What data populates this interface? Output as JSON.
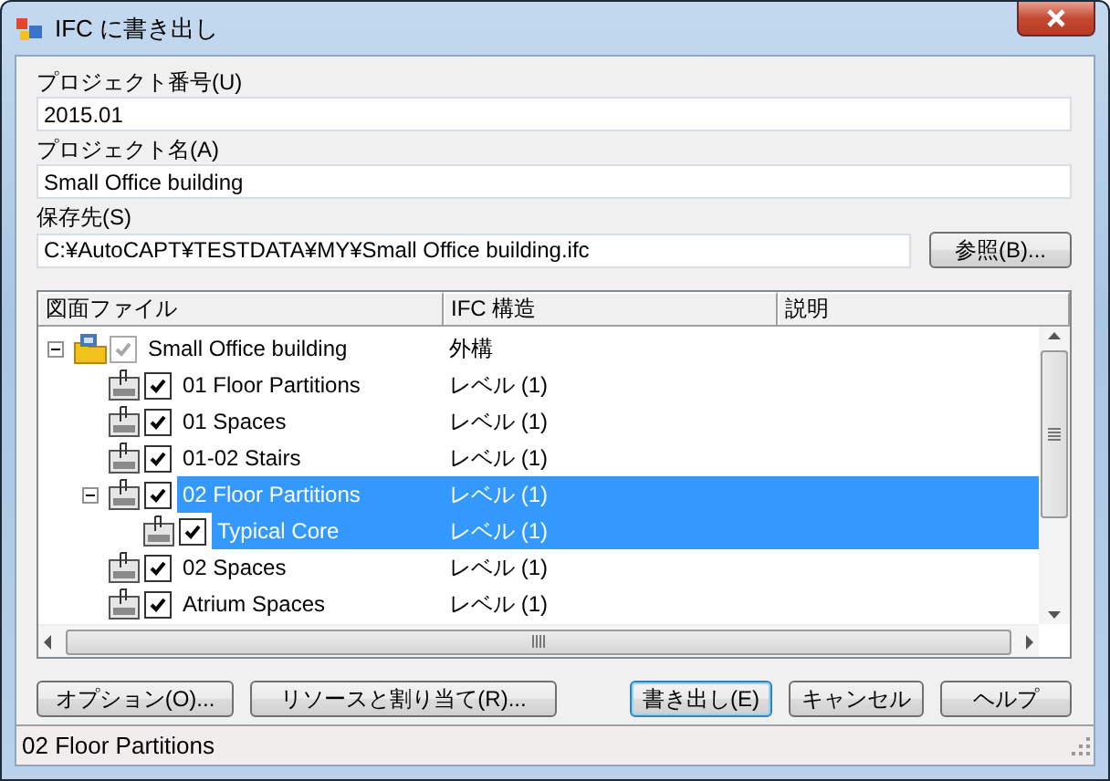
{
  "window": {
    "title": "IFC に書き出し"
  },
  "fields": [
    {
      "label": "プロジェクト番号(U)",
      "value": "2015.01"
    },
    {
      "label": "プロジェクト名(A)",
      "value": "Small Office building"
    },
    {
      "label": "保存先(S)",
      "value": "C:¥AutoCAPT¥TESTDATA¥MY¥Small Office building.ifc",
      "button": "参照(B)..."
    }
  ],
  "tree": {
    "columns": [
      "図面ファイル",
      "IFC 構造",
      "説明"
    ],
    "items": [
      {
        "name": "Small Office building",
        "structure": "外構",
        "kind": "project",
        "checked": true,
        "disabled": true,
        "expanded": true,
        "selected": false,
        "children": [
          {
            "name": "01 Floor Partitions",
            "structure": "レベル (1)",
            "kind": "drawing",
            "checked": true,
            "disabled": false,
            "selected": false
          },
          {
            "name": "01 Spaces",
            "structure": "レベル (1)",
            "kind": "drawing",
            "checked": true,
            "disabled": false,
            "selected": false
          },
          {
            "name": "01-02 Stairs",
            "structure": "レベル (1)",
            "kind": "drawing",
            "checked": true,
            "disabled": false,
            "selected": false
          },
          {
            "name": "02 Floor Partitions",
            "structure": "レベル (1)",
            "kind": "drawing",
            "checked": true,
            "disabled": false,
            "expanded": true,
            "selected": true,
            "children": [
              {
                "name": "Typical Core",
                "structure": "レベル (1)",
                "kind": "drawing",
                "checked": true,
                "disabled": false,
                "selected": true
              }
            ]
          },
          {
            "name": "02 Spaces",
            "structure": "レベル (1)",
            "kind": "drawing",
            "checked": true,
            "disabled": false,
            "selected": false
          },
          {
            "name": "Atrium Spaces",
            "structure": "レベル (1)",
            "kind": "drawing",
            "checked": true,
            "disabled": false,
            "selected": false
          }
        ]
      }
    ]
  },
  "buttons": [
    {
      "label": "オプション(O)...",
      "default": false
    },
    {
      "label": "リソースと割り当て(R)...",
      "default": false
    },
    {
      "label": "書き出し(E)",
      "default": true
    },
    {
      "label": "キャンセル",
      "default": false
    },
    {
      "label": "ヘルプ",
      "default": false
    }
  ],
  "status_bar": "02 Floor Partitions"
}
